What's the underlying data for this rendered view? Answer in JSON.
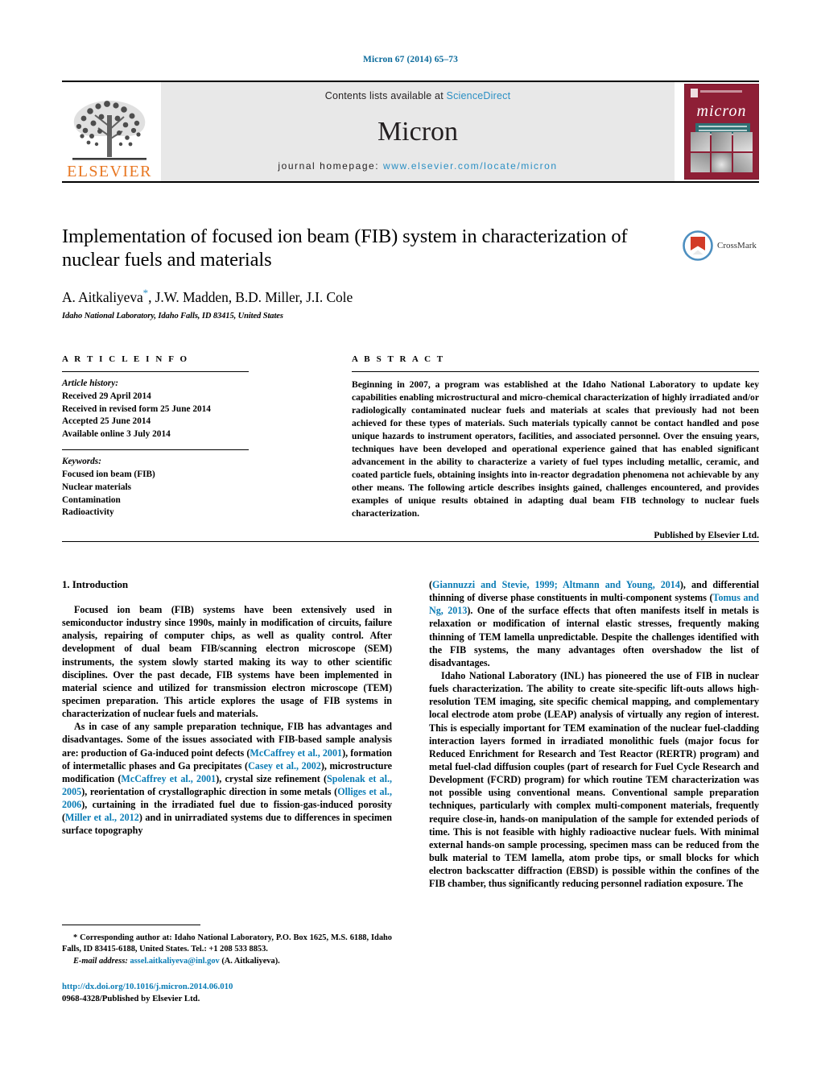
{
  "running_head": "Micron 67 (2014) 65–73",
  "masthead": {
    "publisher_name": "ELSEVIER",
    "contents_prefix": "Contents lists available at ",
    "contents_link": "ScienceDirect",
    "journal_name": "Micron",
    "homepage_prefix": "journal homepage: ",
    "homepage_url": "www.elsevier.com/locate/micron",
    "cover_title": "micron"
  },
  "article": {
    "title": "Implementation of focused ion beam (FIB) system in characterization of nuclear fuels and materials",
    "authors": "A. Aitkaliyeva",
    "authors_rest": ", J.W. Madden, B.D. Miller, J.I. Cole",
    "affiliation": "Idaho National Laboratory, Idaho Falls, ID 83415, United States",
    "crossmark_label": "CrossMark"
  },
  "info": {
    "heading": "A R T I C L E   I N F O",
    "history_label": "Article history:",
    "history": [
      "Received 29 April 2014",
      "Received in revised form 25 June 2014",
      "Accepted 25 June 2014",
      "Available online 3 July 2014"
    ],
    "keywords_label": "Keywords:",
    "keywords": [
      "Focused ion beam (FIB)",
      "Nuclear materials",
      "Contamination",
      "Radioactivity"
    ]
  },
  "abstract": {
    "heading": "A B S T R A C T",
    "text": "Beginning in 2007, a program was established at the Idaho National Laboratory to update key capabilities enabling microstructural and micro-chemical characterization of highly irradiated and/or radiologically contaminated nuclear fuels and materials at scales that previously had not been achieved for these types of materials. Such materials typically cannot be contact handled and pose unique hazards to instrument operators, facilities, and associated personnel. Over the ensuing years, techniques have been developed and operational experience gained that has enabled significant advancement in the ability to characterize a variety of fuel types including metallic, ceramic, and coated particle fuels, obtaining insights into in-reactor degradation phenomena not achievable by any other means. The following article describes insights gained, challenges encountered, and provides examples of unique results obtained in adapting dual beam FIB technology to nuclear fuels characterization.",
    "publisher_line": "Published by Elsevier Ltd."
  },
  "body": {
    "section_title": "1.  Introduction",
    "left": {
      "p1": "Focused ion beam (FIB) systems have been extensively used in semiconductor industry since 1990s, mainly in modification of circuits, failure analysis, repairing of computer chips, as well as quality control. After development of dual beam FIB/scanning electron microscope (SEM) instruments, the system slowly started making its way to other scientific disciplines. Over the past decade, FIB systems have been implemented in material science and utilized for transmission electron microscope (TEM) specimen preparation. This article explores the usage of FIB systems in characterization of nuclear fuels and materials.",
      "p2_a": "As in case of any sample preparation technique, FIB has advantages and disadvantages. Some of the issues associated with FIB-based sample analysis are: production of Ga-induced point defects (",
      "p2_ref1": "McCaffrey et al., 2001",
      "p2_b": "), formation of intermetallic phases and Ga precipitates (",
      "p2_ref2": "Casey et al., 2002",
      "p2_c": "), microstructure modification (",
      "p2_ref3": "McCaffrey et al., 2001",
      "p2_d": "), crystal size refinement (",
      "p2_ref4": "Spolenak et al., 2005",
      "p2_e": "), reorientation of crystallographic direction in some metals (",
      "p2_ref5": "Olliges et al., 2006",
      "p2_f": "), curtaining in the irradiated fuel due to fission-gas-induced porosity (",
      "p2_ref6": "Miller et al., 2012",
      "p2_g": ") and in unirradiated systems due to differences in specimen surface topography"
    },
    "right": {
      "p2_cont_a": "(",
      "p2_ref7": "Giannuzzi and Stevie, 1999; Altmann and Young, 2014",
      "p2_cont_b": "), and differential thinning of diverse phase constituents in multi-component systems (",
      "p2_ref8": "Tomus and Ng, 2013",
      "p2_cont_c": "). One of the surface effects that often manifests itself in metals is relaxation or modification of internal elastic stresses, frequently making thinning of TEM lamella unpredictable. Despite the challenges identified with the FIB systems, the many advantages often overshadow the list of disadvantages.",
      "p3": "Idaho National Laboratory (INL) has pioneered the use of FIB in nuclear fuels characterization. The ability to create site-specific lift-outs allows high-resolution TEM imaging, site specific chemical mapping, and complementary local electrode atom probe (LEAP) analysis of virtually any region of interest. This is especially important for TEM examination of the nuclear fuel-cladding interaction layers formed in irradiated monolithic fuels (major focus for Reduced Enrichment for Research and Test Reactor (RERTR) program) and metal fuel-clad diffusion couples (part of research for Fuel Cycle Research and Development (FCRD) program) for which routine TEM characterization was not possible using conventional means. Conventional sample preparation techniques, particularly with complex multi-component materials, frequently require close-in, hands-on manipulation of the sample for extended periods of time. This is not feasible with highly radioactive nuclear fuels. With minimal external hands-on sample processing, specimen mass can be reduced from the bulk material to TEM lamella, atom probe tips, or small blocks for which electron backscatter diffraction (EBSD) is possible within the confines of the FIB chamber, thus significantly reducing personnel radiation exposure. The"
    }
  },
  "footnote": {
    "star": "*",
    "corresponding": " Corresponding author at: Idaho National Laboratory, P.O. Box 1625, M.S. 6188, Idaho Falls, ID 83415-6188, United States. Tel.: +1 208 533 8853.",
    "email_label": "E-mail address: ",
    "email": "assel.aitkaliyeva@inl.gov",
    "email_owner": " (A. Aitkaliyeva)."
  },
  "doi": {
    "url": "http://dx.doi.org/10.1016/j.micron.2014.06.010",
    "issn_line": "0968-4328/Published by Elsevier Ltd."
  },
  "colors": {
    "link": "#0a7cb5",
    "running_head": "#0a6a9b",
    "elsevier_orange": "#e87722",
    "cover_maroon": "#8e1f36",
    "masthead_grey": "#e8e8e8"
  }
}
